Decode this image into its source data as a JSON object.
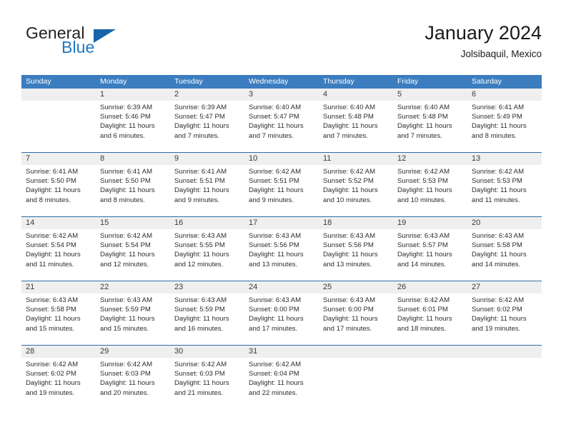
{
  "brand": {
    "name_part1": "General",
    "name_part2": "Blue",
    "logo_icon": "blue-triangle-flag-icon"
  },
  "header": {
    "title": "January 2024",
    "subtitle": "Jolsibaquil, Mexico"
  },
  "colors": {
    "header_blue": "#3b7dbf",
    "row_divider_blue": "#2e6da4",
    "daynum_band_gray": "#efefef",
    "brand_blue": "#1f78c1",
    "logo_blue": "#1565a8",
    "text_dark": "#2d2d2d"
  },
  "weekday_headers": [
    "Sunday",
    "Monday",
    "Tuesday",
    "Wednesday",
    "Thursday",
    "Friday",
    "Saturday"
  ],
  "weeks": [
    [
      {
        "day": "",
        "empty": true,
        "sunrise": "",
        "sunset": "",
        "daylight_line1": "",
        "daylight_line2": ""
      },
      {
        "day": "1",
        "empty": false,
        "sunrise": "Sunrise: 6:39 AM",
        "sunset": "Sunset: 5:46 PM",
        "daylight_line1": "Daylight: 11 hours",
        "daylight_line2": "and 6 minutes."
      },
      {
        "day": "2",
        "empty": false,
        "sunrise": "Sunrise: 6:39 AM",
        "sunset": "Sunset: 5:47 PM",
        "daylight_line1": "Daylight: 11 hours",
        "daylight_line2": "and 7 minutes."
      },
      {
        "day": "3",
        "empty": false,
        "sunrise": "Sunrise: 6:40 AM",
        "sunset": "Sunset: 5:47 PM",
        "daylight_line1": "Daylight: 11 hours",
        "daylight_line2": "and 7 minutes."
      },
      {
        "day": "4",
        "empty": false,
        "sunrise": "Sunrise: 6:40 AM",
        "sunset": "Sunset: 5:48 PM",
        "daylight_line1": "Daylight: 11 hours",
        "daylight_line2": "and 7 minutes."
      },
      {
        "day": "5",
        "empty": false,
        "sunrise": "Sunrise: 6:40 AM",
        "sunset": "Sunset: 5:48 PM",
        "daylight_line1": "Daylight: 11 hours",
        "daylight_line2": "and 7 minutes."
      },
      {
        "day": "6",
        "empty": false,
        "sunrise": "Sunrise: 6:41 AM",
        "sunset": "Sunset: 5:49 PM",
        "daylight_line1": "Daylight: 11 hours",
        "daylight_line2": "and 8 minutes."
      }
    ],
    [
      {
        "day": "7",
        "empty": false,
        "sunrise": "Sunrise: 6:41 AM",
        "sunset": "Sunset: 5:50 PM",
        "daylight_line1": "Daylight: 11 hours",
        "daylight_line2": "and 8 minutes."
      },
      {
        "day": "8",
        "empty": false,
        "sunrise": "Sunrise: 6:41 AM",
        "sunset": "Sunset: 5:50 PM",
        "daylight_line1": "Daylight: 11 hours",
        "daylight_line2": "and 8 minutes."
      },
      {
        "day": "9",
        "empty": false,
        "sunrise": "Sunrise: 6:41 AM",
        "sunset": "Sunset: 5:51 PM",
        "daylight_line1": "Daylight: 11 hours",
        "daylight_line2": "and 9 minutes."
      },
      {
        "day": "10",
        "empty": false,
        "sunrise": "Sunrise: 6:42 AM",
        "sunset": "Sunset: 5:51 PM",
        "daylight_line1": "Daylight: 11 hours",
        "daylight_line2": "and 9 minutes."
      },
      {
        "day": "11",
        "empty": false,
        "sunrise": "Sunrise: 6:42 AM",
        "sunset": "Sunset: 5:52 PM",
        "daylight_line1": "Daylight: 11 hours",
        "daylight_line2": "and 10 minutes."
      },
      {
        "day": "12",
        "empty": false,
        "sunrise": "Sunrise: 6:42 AM",
        "sunset": "Sunset: 5:53 PM",
        "daylight_line1": "Daylight: 11 hours",
        "daylight_line2": "and 10 minutes."
      },
      {
        "day": "13",
        "empty": false,
        "sunrise": "Sunrise: 6:42 AM",
        "sunset": "Sunset: 5:53 PM",
        "daylight_line1": "Daylight: 11 hours",
        "daylight_line2": "and 11 minutes."
      }
    ],
    [
      {
        "day": "14",
        "empty": false,
        "sunrise": "Sunrise: 6:42 AM",
        "sunset": "Sunset: 5:54 PM",
        "daylight_line1": "Daylight: 11 hours",
        "daylight_line2": "and 11 minutes."
      },
      {
        "day": "15",
        "empty": false,
        "sunrise": "Sunrise: 6:42 AM",
        "sunset": "Sunset: 5:54 PM",
        "daylight_line1": "Daylight: 11 hours",
        "daylight_line2": "and 12 minutes."
      },
      {
        "day": "16",
        "empty": false,
        "sunrise": "Sunrise: 6:43 AM",
        "sunset": "Sunset: 5:55 PM",
        "daylight_line1": "Daylight: 11 hours",
        "daylight_line2": "and 12 minutes."
      },
      {
        "day": "17",
        "empty": false,
        "sunrise": "Sunrise: 6:43 AM",
        "sunset": "Sunset: 5:56 PM",
        "daylight_line1": "Daylight: 11 hours",
        "daylight_line2": "and 13 minutes."
      },
      {
        "day": "18",
        "empty": false,
        "sunrise": "Sunrise: 6:43 AM",
        "sunset": "Sunset: 5:56 PM",
        "daylight_line1": "Daylight: 11 hours",
        "daylight_line2": "and 13 minutes."
      },
      {
        "day": "19",
        "empty": false,
        "sunrise": "Sunrise: 6:43 AM",
        "sunset": "Sunset: 5:57 PM",
        "daylight_line1": "Daylight: 11 hours",
        "daylight_line2": "and 14 minutes."
      },
      {
        "day": "20",
        "empty": false,
        "sunrise": "Sunrise: 6:43 AM",
        "sunset": "Sunset: 5:58 PM",
        "daylight_line1": "Daylight: 11 hours",
        "daylight_line2": "and 14 minutes."
      }
    ],
    [
      {
        "day": "21",
        "empty": false,
        "sunrise": "Sunrise: 6:43 AM",
        "sunset": "Sunset: 5:58 PM",
        "daylight_line1": "Daylight: 11 hours",
        "daylight_line2": "and 15 minutes."
      },
      {
        "day": "22",
        "empty": false,
        "sunrise": "Sunrise: 6:43 AM",
        "sunset": "Sunset: 5:59 PM",
        "daylight_line1": "Daylight: 11 hours",
        "daylight_line2": "and 15 minutes."
      },
      {
        "day": "23",
        "empty": false,
        "sunrise": "Sunrise: 6:43 AM",
        "sunset": "Sunset: 5:59 PM",
        "daylight_line1": "Daylight: 11 hours",
        "daylight_line2": "and 16 minutes."
      },
      {
        "day": "24",
        "empty": false,
        "sunrise": "Sunrise: 6:43 AM",
        "sunset": "Sunset: 6:00 PM",
        "daylight_line1": "Daylight: 11 hours",
        "daylight_line2": "and 17 minutes."
      },
      {
        "day": "25",
        "empty": false,
        "sunrise": "Sunrise: 6:43 AM",
        "sunset": "Sunset: 6:00 PM",
        "daylight_line1": "Daylight: 11 hours",
        "daylight_line2": "and 17 minutes."
      },
      {
        "day": "26",
        "empty": false,
        "sunrise": "Sunrise: 6:42 AM",
        "sunset": "Sunset: 6:01 PM",
        "daylight_line1": "Daylight: 11 hours",
        "daylight_line2": "and 18 minutes."
      },
      {
        "day": "27",
        "empty": false,
        "sunrise": "Sunrise: 6:42 AM",
        "sunset": "Sunset: 6:02 PM",
        "daylight_line1": "Daylight: 11 hours",
        "daylight_line2": "and 19 minutes."
      }
    ],
    [
      {
        "day": "28",
        "empty": false,
        "sunrise": "Sunrise: 6:42 AM",
        "sunset": "Sunset: 6:02 PM",
        "daylight_line1": "Daylight: 11 hours",
        "daylight_line2": "and 19 minutes."
      },
      {
        "day": "29",
        "empty": false,
        "sunrise": "Sunrise: 6:42 AM",
        "sunset": "Sunset: 6:03 PM",
        "daylight_line1": "Daylight: 11 hours",
        "daylight_line2": "and 20 minutes."
      },
      {
        "day": "30",
        "empty": false,
        "sunrise": "Sunrise: 6:42 AM",
        "sunset": "Sunset: 6:03 PM",
        "daylight_line1": "Daylight: 11 hours",
        "daylight_line2": "and 21 minutes."
      },
      {
        "day": "31",
        "empty": false,
        "sunrise": "Sunrise: 6:42 AM",
        "sunset": "Sunset: 6:04 PM",
        "daylight_line1": "Daylight: 11 hours",
        "daylight_line2": "and 22 minutes."
      },
      {
        "day": "",
        "empty": true,
        "sunrise": "",
        "sunset": "",
        "daylight_line1": "",
        "daylight_line2": ""
      },
      {
        "day": "",
        "empty": true,
        "sunrise": "",
        "sunset": "",
        "daylight_line1": "",
        "daylight_line2": ""
      },
      {
        "day": "",
        "empty": true,
        "sunrise": "",
        "sunset": "",
        "daylight_line1": "",
        "daylight_line2": ""
      }
    ]
  ]
}
